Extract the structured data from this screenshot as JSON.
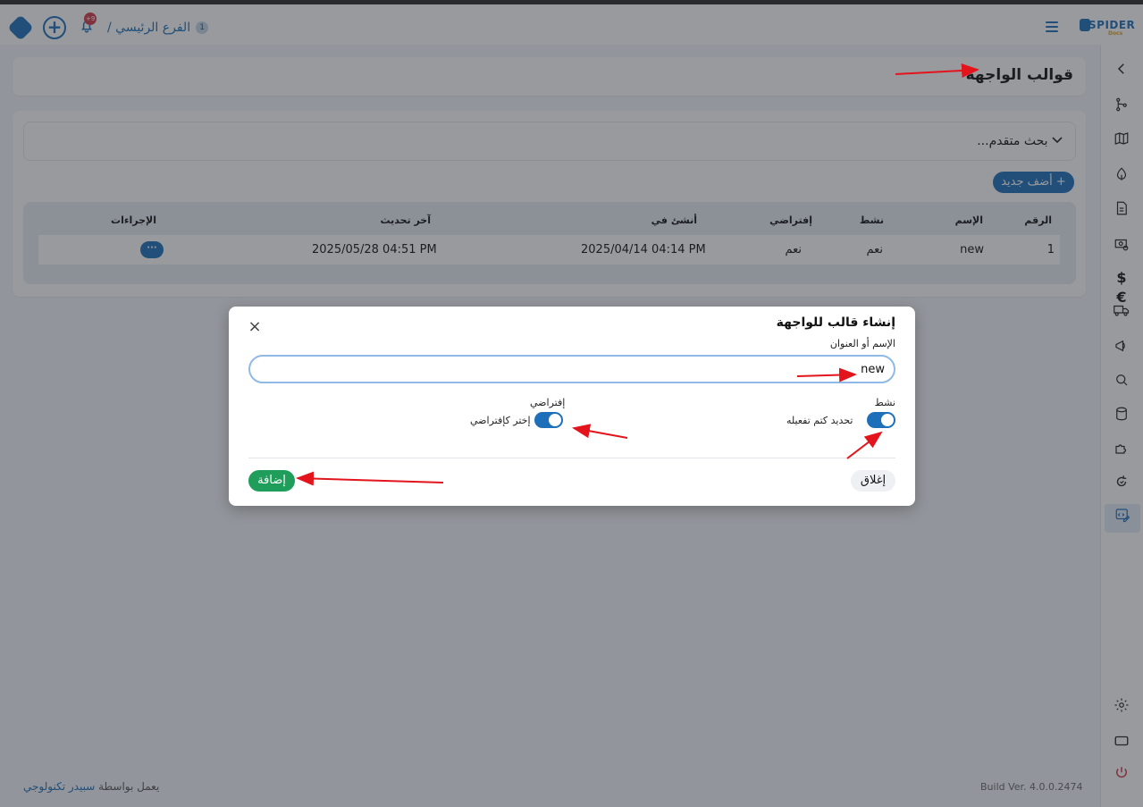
{
  "topbar": {
    "logo_text": "SPIDER",
    "logo_sub": "Docs",
    "notifications_badge": "+9",
    "branch_number": "1",
    "branch_name": "الفرع الرئيسي /"
  },
  "page": {
    "title": "قوالب الواجهة",
    "search_toggle": "بحث متقدم...",
    "add_new_button": "+ أضف جديد"
  },
  "table": {
    "headers": {
      "number": "الرقم",
      "name": "الإسم",
      "active": "نشط",
      "default": "إفتراضي",
      "created_at": "أنشئ في",
      "updated_at": "آخر تحديث",
      "actions": "الإجراءات"
    },
    "rows": [
      {
        "number": "1",
        "name": "new",
        "active": "نعم",
        "default": "نعم",
        "created_at": "2025/04/14 04:14 PM",
        "updated_at": "2025/05/28 04:51 PM",
        "actions": "···"
      }
    ]
  },
  "footer": {
    "powered_prefix": "يعمل بواسطة",
    "powered_brand": "سبيدر تكنولوجي",
    "build": "Build Ver. 4.0.0.2474"
  },
  "modal": {
    "title": "إنشاء قالب للواجهة",
    "close_icon": "×",
    "name_label": "الإسم أو العنوان",
    "name_value": "new",
    "active_label": "نشط",
    "active_toggle_text": "تحديد كتم تفعيله",
    "active_on": true,
    "default_label": "إفتراضي",
    "default_toggle_text": "إختر كإفتراضي",
    "default_on": true,
    "close_button": "إغلاق",
    "submit_button": "إضافة"
  },
  "sidebar": {
    "icons": [
      "chevron-left-icon",
      "branch-icon",
      "map-icon",
      "leaf-icon",
      "invoice-icon",
      "money-settings-icon",
      "currency-icon",
      "truck-icon",
      "megaphone-icon",
      "search-doc-icon",
      "database-icon",
      "puzzle-icon",
      "refresh-icon",
      "template-edit-icon",
      "gear-icon",
      "screen-icon",
      "power-icon"
    ]
  },
  "colors": {
    "primary": "#1c6fb8",
    "success": "#1e9e5a",
    "danger": "#d23a4a",
    "annotation": "#e3141c"
  }
}
